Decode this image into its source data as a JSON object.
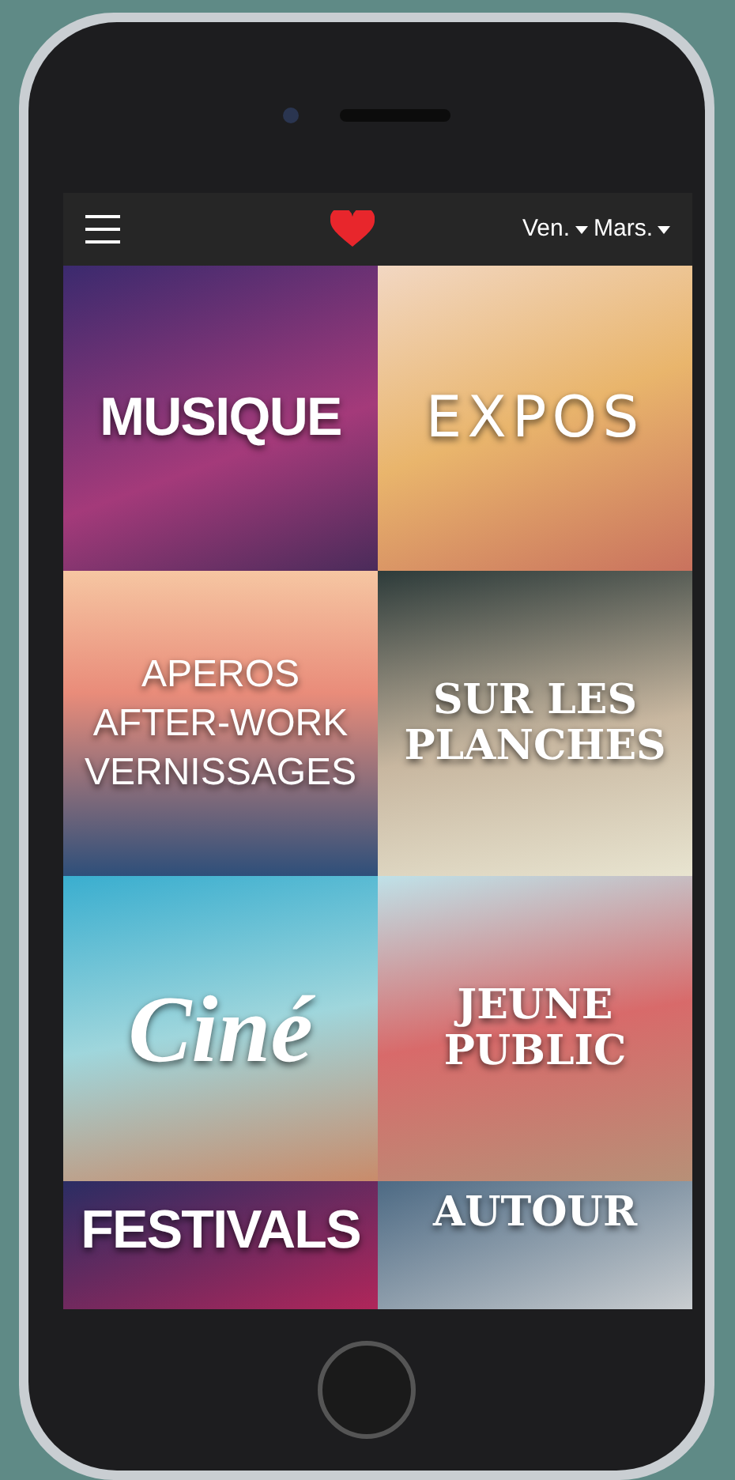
{
  "header": {
    "dropdowns": [
      {
        "label": "Ven."
      },
      {
        "label": "Mars."
      }
    ]
  },
  "tiles": [
    {
      "kind": "block",
      "lines": [
        "MUSIQUE"
      ]
    },
    {
      "kind": "neon",
      "lines": [
        "EXPOS"
      ]
    },
    {
      "kind": "thin",
      "lines": [
        "APEROS",
        "AFTER-WORK",
        "VERNISSAGES"
      ]
    },
    {
      "kind": "serif",
      "lines": [
        "SUR LES",
        "PLANCHES"
      ]
    },
    {
      "kind": "script",
      "lines": [
        "Ciné"
      ]
    },
    {
      "kind": "serif",
      "lines": [
        "JEUNE",
        "PUBLIC"
      ]
    },
    {
      "kind": "block",
      "lines": [
        "FESTIVALS"
      ]
    },
    {
      "kind": "serif",
      "lines": [
        "AUTOUR"
      ]
    }
  ]
}
